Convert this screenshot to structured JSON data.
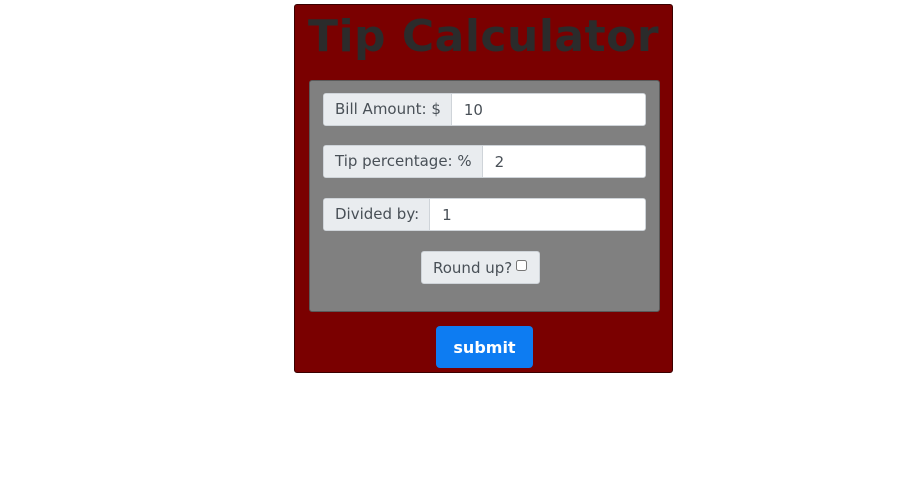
{
  "app": {
    "title": "Tip Calculator"
  },
  "form": {
    "bill": {
      "label": "Bill Amount: $",
      "value": "10"
    },
    "tip": {
      "label": "Tip percentage: %",
      "value": "2"
    },
    "divided": {
      "label": "Divided by:",
      "value": "1"
    },
    "round_up": {
      "label": "Round up?",
      "checked": false
    }
  },
  "actions": {
    "submit_label": "submit"
  },
  "colors": {
    "panel_bg": "#7a0000",
    "form_bg": "#808080",
    "accent": "#0d7cf2"
  }
}
